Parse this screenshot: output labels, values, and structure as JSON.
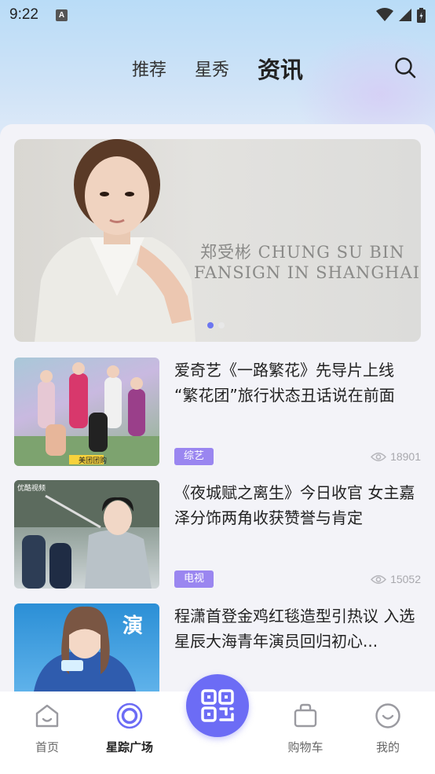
{
  "status_bar": {
    "time": "9:22",
    "notification_icon": "A"
  },
  "top_tabs": [
    {
      "label": "推荐",
      "active": false
    },
    {
      "label": "星秀",
      "active": false
    },
    {
      "label": "资讯",
      "active": true
    }
  ],
  "banner": {
    "line1": "郑受彬  CHUNG SU BIN",
    "line2": "FANSIGN IN SHANGHAI",
    "page_count": 2,
    "active_page": 1
  },
  "news": [
    {
      "title": "爱奇艺《一路繁花》先导片上线 “繁花团”旅行状态丑话说在前面",
      "tag": "综艺",
      "views": "18901",
      "thumb_badge": "美团团购"
    },
    {
      "title": "《夜城赋之离生》今日收官 女主嘉泽分饰两角收获赞誉与肯定",
      "tag": "电视",
      "views": "15052",
      "thumb_badge": "优酷视频"
    },
    {
      "title": "程潇首登金鸡红毯造型引热议 入选星辰大海青年演员回归初心...",
      "tag": "",
      "views": "",
      "thumb_badge": "演"
    }
  ],
  "bottom_nav": [
    {
      "label": "首页",
      "icon": "home-icon",
      "active": false
    },
    {
      "label": "星踪广场",
      "icon": "target-icon",
      "active": true
    },
    {
      "label": "",
      "icon": "qr-code-icon",
      "active": false
    },
    {
      "label": "购物车",
      "icon": "shopping-bag-icon",
      "active": false
    },
    {
      "label": "我的",
      "icon": "smile-icon",
      "active": false
    }
  ],
  "colors": {
    "accent": "#6c6cf5",
    "tag_bg": "#9a86f0",
    "header_gradient_top": "#b9dcf7",
    "banner_bg": "#dcdcd8"
  }
}
